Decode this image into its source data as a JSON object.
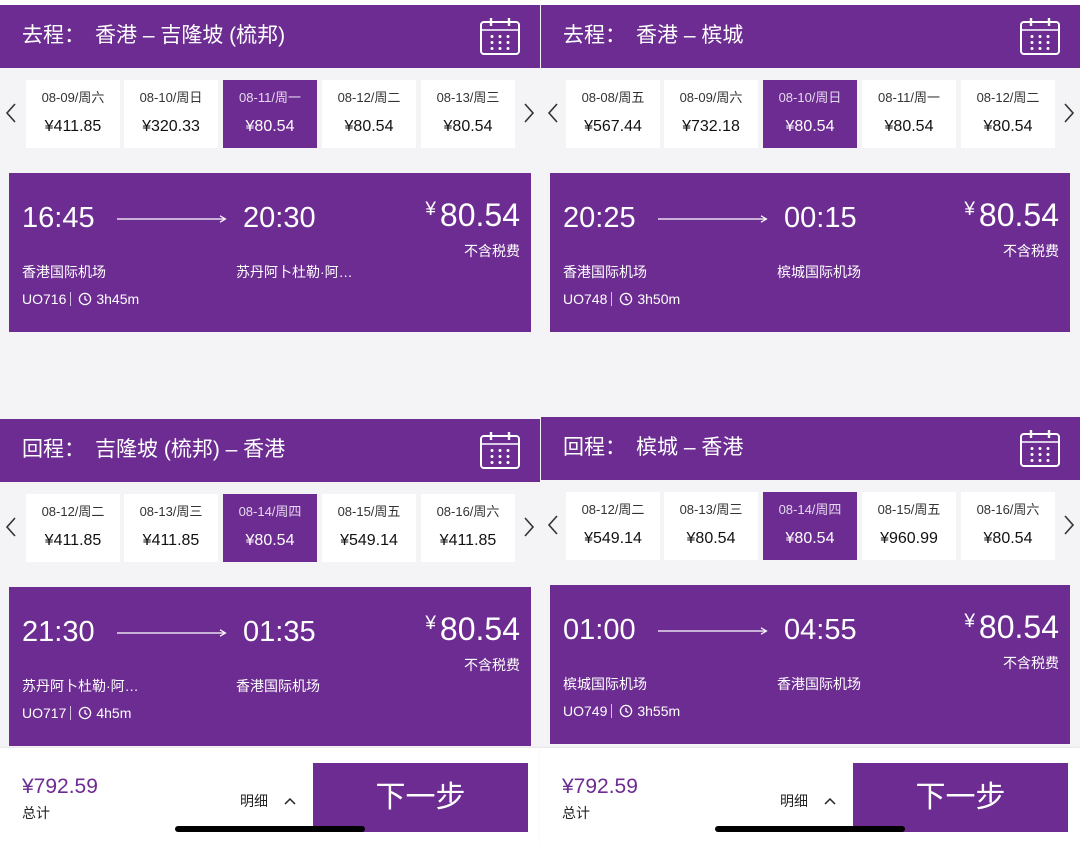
{
  "colors": {
    "brand_purple": "#6c2c91",
    "page_background": "#f4f4f6",
    "date_cell_background": "#ffffff",
    "selected_date_subtext": "#e6d9ee",
    "text_primary": "#1c1c1e",
    "home_indicator": "#000000"
  },
  "icons": {
    "calendar": "calendar-icon",
    "previous_dates": "chevron-left-icon",
    "next_dates": "chevron-right-icon",
    "route_arrow": "arrow-right-icon",
    "duration": "clock-icon",
    "details_toggle": "chevron-up-icon"
  },
  "left": {
    "outbound": {
      "direction_label": "去程：",
      "route": "香港 – 吉隆坡 (梳邦)",
      "dates": [
        {
          "date": "08-09/周六",
          "price": "¥411.85",
          "selected": false
        },
        {
          "date": "08-10/周日",
          "price": "¥320.33",
          "selected": false
        },
        {
          "date": "08-11/周一",
          "price": "¥80.54",
          "selected": true
        },
        {
          "date": "08-12/周二",
          "price": "¥80.54",
          "selected": false
        },
        {
          "date": "08-13/周三",
          "price": "¥80.54",
          "selected": false
        }
      ],
      "flight": {
        "depart_time": "16:45",
        "arrive_time": "20:30",
        "price_symbol": "¥",
        "price_amount": "80.54",
        "price_note": "不含税费",
        "depart_airport": "香港国际机场",
        "arrive_airport": "苏丹阿卜杜勒·阿…",
        "flight_no": "UO716",
        "duration": "3h45m"
      }
    },
    "inbound": {
      "direction_label": "回程：",
      "route": "吉隆坡 (梳邦) – 香港",
      "dates": [
        {
          "date": "08-12/周二",
          "price": "¥411.85",
          "selected": false
        },
        {
          "date": "08-13/周三",
          "price": "¥411.85",
          "selected": false
        },
        {
          "date": "08-14/周四",
          "price": "¥80.54",
          "selected": true
        },
        {
          "date": "08-15/周五",
          "price": "¥549.14",
          "selected": false
        },
        {
          "date": "08-16/周六",
          "price": "¥411.85",
          "selected": false
        }
      ],
      "flight": {
        "depart_time": "21:30",
        "arrive_time": "01:35",
        "price_symbol": "¥",
        "price_amount": "80.54",
        "price_note": "不含税费",
        "depart_airport": "苏丹阿卜杜勒·阿…",
        "arrive_airport": "香港国际机场",
        "flight_no": "UO717",
        "duration": "4h5m"
      }
    },
    "footer": {
      "total_price": "¥792.59",
      "total_label": "总计",
      "details_label": "明细",
      "next_label": "下一步"
    }
  },
  "right": {
    "outbound": {
      "direction_label": "去程：",
      "route": "香港 – 槟城",
      "dates": [
        {
          "date": "08-08/周五",
          "price": "¥567.44",
          "selected": false
        },
        {
          "date": "08-09/周六",
          "price": "¥732.18",
          "selected": false
        },
        {
          "date": "08-10/周日",
          "price": "¥80.54",
          "selected": true
        },
        {
          "date": "08-11/周一",
          "price": "¥80.54",
          "selected": false
        },
        {
          "date": "08-12/周二",
          "price": "¥80.54",
          "selected": false
        }
      ],
      "flight": {
        "depart_time": "20:25",
        "arrive_time": "00:15",
        "price_symbol": "¥",
        "price_amount": "80.54",
        "price_note": "不含税费",
        "depart_airport": "香港国际机场",
        "arrive_airport": "槟城国际机场",
        "flight_no": "UO748",
        "duration": "3h50m"
      }
    },
    "inbound": {
      "direction_label": "回程：",
      "route": "槟城 – 香港",
      "dates": [
        {
          "date": "08-12/周二",
          "price": "¥549.14",
          "selected": false
        },
        {
          "date": "08-13/周三",
          "price": "¥80.54",
          "selected": false
        },
        {
          "date": "08-14/周四",
          "price": "¥80.54",
          "selected": true
        },
        {
          "date": "08-15/周五",
          "price": "¥960.99",
          "selected": false
        },
        {
          "date": "08-16/周六",
          "price": "¥80.54",
          "selected": false
        }
      ],
      "flight": {
        "depart_time": "01:00",
        "arrive_time": "04:55",
        "price_symbol": "¥",
        "price_amount": "80.54",
        "price_note": "不含税费",
        "depart_airport": "槟城国际机场",
        "arrive_airport": "香港国际机场",
        "flight_no": "UO749",
        "duration": "3h55m"
      }
    },
    "footer": {
      "total_price": "¥792.59",
      "total_label": "总计",
      "details_label": "明细",
      "next_label": "下一步"
    }
  }
}
